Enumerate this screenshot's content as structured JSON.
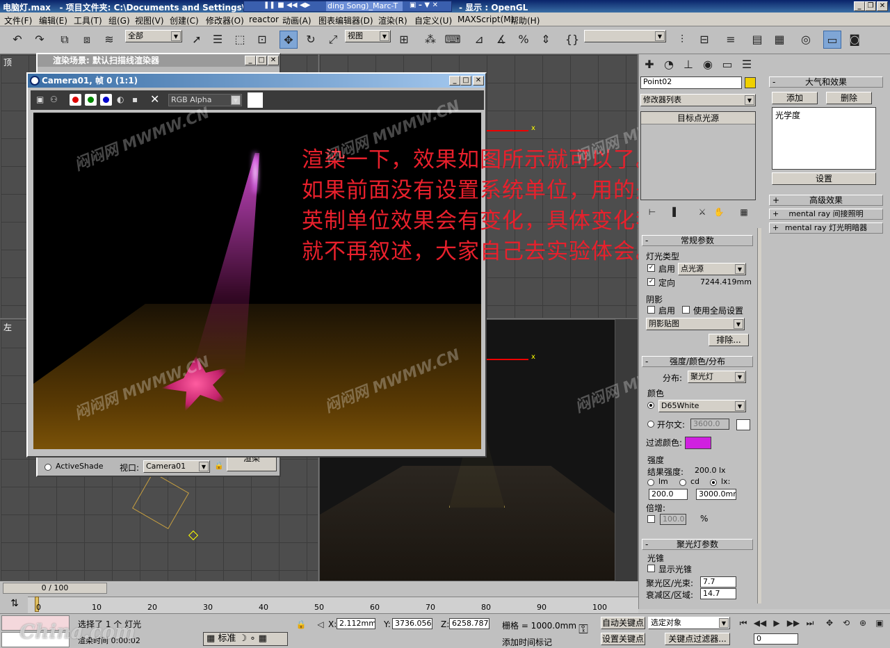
{
  "window": {
    "title_file": "电脑灯.max",
    "title_project": "- 项目文件夹: C:\\Documents and Settings\\",
    "title_media": "ding Song)_Marc-T",
    "title_display": "- 显示 : OpenGL"
  },
  "menu": [
    "文件(F)",
    "编辑(E)",
    "工具(T)",
    "组(G)",
    "视图(V)",
    "创建(C)",
    "修改器(O)",
    "reactor",
    "动画(A)",
    "图表编辑器(D)",
    "渲染(R)",
    "自定义(U)",
    "MAXScript(M)",
    "帮助(H)"
  ],
  "toolbar": {
    "selection_filter": "全部",
    "ref_coord": "视图",
    "named_sel": ""
  },
  "viewports": {
    "top_label": "顶",
    "left_label": "左"
  },
  "render_window": {
    "title": "Camera01, 帧 0 (1:1)",
    "channel": "RGB Alpha"
  },
  "scene_window": {
    "title": "渲染场景: 默认扫描线渲染器",
    "activeshade": "ActiveShade",
    "viewport_label": "视口:",
    "viewport_value": "Camera01",
    "render_btn": "渲染"
  },
  "caption": [
    "渲染一下，效果如图所示就可以了。",
    "如果前面没有设置系统单位，用的是",
    "英制单位效果会有变化，具体变化我",
    "就不再叙述，大家自己去实验体会。"
  ],
  "watermark": "MWMW.CN",
  "watermark2": "闷闷网",
  "cmd": {
    "object_name": "Point02",
    "object_color": "#f0d000",
    "modifier_list": "修改器列表",
    "stack_item": "目标点光源",
    "general_title": "常规参数",
    "light_type": "灯光类型",
    "enabled": "启用",
    "light_kind": "点光源",
    "targeted": "定向",
    "target_dist": "7244.419mm",
    "shadows": "阴影",
    "shadow_on": "启用",
    "shadow_global": "使用全局设置",
    "shadow_type": "阴影贴图",
    "exclude": "排除...",
    "intensity_title": "强度/颜色/分布",
    "distribution_label": "分布:",
    "distribution": "聚光灯",
    "color_label": "颜色",
    "d65": "D65White",
    "kelvin": "开尔文:",
    "kelvin_value": "3600.0",
    "filter_color": "过滤颜色:",
    "filter_swatch": "#d020e0",
    "strength": "强度",
    "result_intensity": "结果强度:",
    "result_value": "200.0 lx",
    "unit_lm": "lm",
    "unit_cd": "cd",
    "unit_lx": "lx:",
    "lx_value": "200.0",
    "lx_dist": "3000.0mm",
    "multiplier": "倍增:",
    "mult_value": "100.0",
    "pct": "%",
    "spot_title": "聚光灯参数",
    "cone": "光锥",
    "show_cone": "显示光锥",
    "hotspot": "聚光区/光束:",
    "hotspot_value": "7.7",
    "falloff": "衰减区/区域:",
    "falloff_value": "14.7"
  },
  "right": {
    "atmos_title": "大气和效果",
    "add": "添加",
    "delete": "删除",
    "list_item": "光学度",
    "setup": "设置",
    "advanced": "高级效果",
    "mr_gi": "mental ray 间接照明",
    "mr_shadow": "mental ray 灯光明暗器"
  },
  "status": {
    "time_slider": "0 / 100",
    "ticks": [
      "0",
      "10",
      "20",
      "30",
      "40",
      "50",
      "60",
      "70",
      "80",
      "90",
      "100"
    ],
    "selected": "选择了 1 个 灯光",
    "render_time": "渲染时间  0:00:02",
    "ime": "标准",
    "x": "2.112mm",
    "y": "3736.056m",
    "z": "6258.787m",
    "grid": "栅格 = 1000.0mm",
    "auto_key": "自动关键点",
    "selection_set": "选定对象",
    "set_key": "设置关键点",
    "key_filter": "关键点过滤器...",
    "add_time_tag": "添加时间标记",
    "frame": "0"
  }
}
